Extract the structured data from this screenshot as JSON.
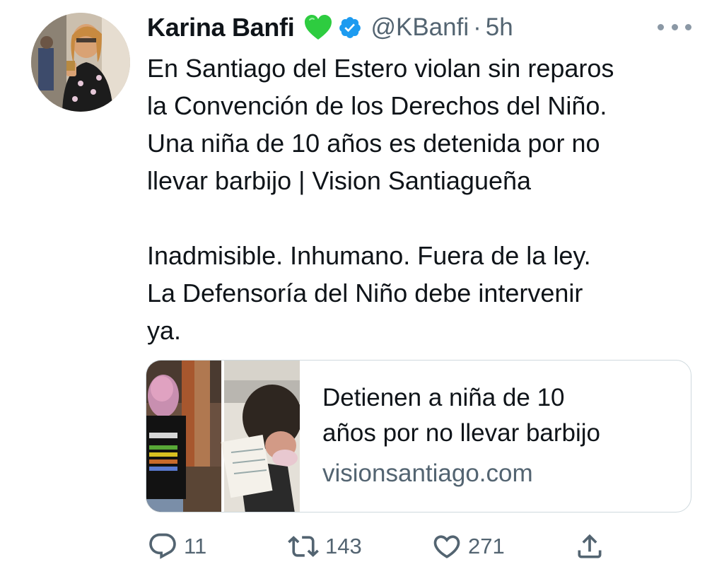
{
  "tweet": {
    "author_name": "Karina Banfi",
    "handle": "@KBanfi",
    "separator": "·",
    "time": "5h",
    "lines": [
      "En Santiago del Estero violan sin reparos",
      "la Convención de los Derechos del Niño.",
      "Una niña de 10 años es detenida por no",
      "llevar barbijo | Vision Santiagueña",
      "",
      "Inadmisible. Inhumano. Fuera de la ley.",
      "La Defensoría del Niño debe intervenir",
      "ya."
    ]
  },
  "card": {
    "title_lines": [
      "Detienen a niña de 10",
      "años por no llevar barbijo"
    ],
    "domain": "visionsantiago.com"
  },
  "actions": {
    "reply_count": "11",
    "retweet_count": "143",
    "like_count": "271"
  },
  "icons": {
    "heart_emoji": "green-heart-icon",
    "verified": "verified-badge-icon",
    "reply": "reply-icon",
    "retweet": "retweet-icon",
    "like": "like-icon",
    "share": "share-icon",
    "more": "more-icon"
  },
  "colors": {
    "verified": "#1d9bf0",
    "heart": "#2ecc40",
    "secondary_text": "#536471"
  }
}
